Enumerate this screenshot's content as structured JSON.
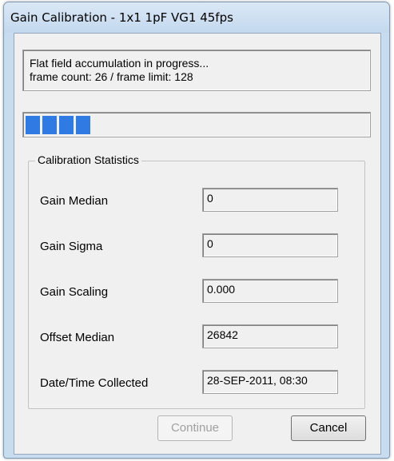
{
  "window": {
    "title": "Gain Calibration - 1x1 1pF VG1 45fps"
  },
  "status": {
    "line1": "Flat field accumulation in progress...",
    "line2": "frame count: 26 / frame limit: 128"
  },
  "progress": {
    "frame_count": 26,
    "frame_limit": 128,
    "fraction": 0.203
  },
  "stats": {
    "group_label": "Calibration Statistics",
    "rows": [
      {
        "label": "Gain Median",
        "value": "0"
      },
      {
        "label": "Gain Sigma",
        "value": "0"
      },
      {
        "label": "Gain Scaling",
        "value": "0.000"
      },
      {
        "label": "Offset Median",
        "value": "26842"
      },
      {
        "label": "Date/Time Collected",
        "value": "28-SEP-2011, 08:30"
      }
    ]
  },
  "buttons": {
    "continue_label": "Continue",
    "cancel_label": "Cancel"
  },
  "colors": {
    "progress_fill": "#2f7be3",
    "window_frame": "#c7dcef"
  }
}
